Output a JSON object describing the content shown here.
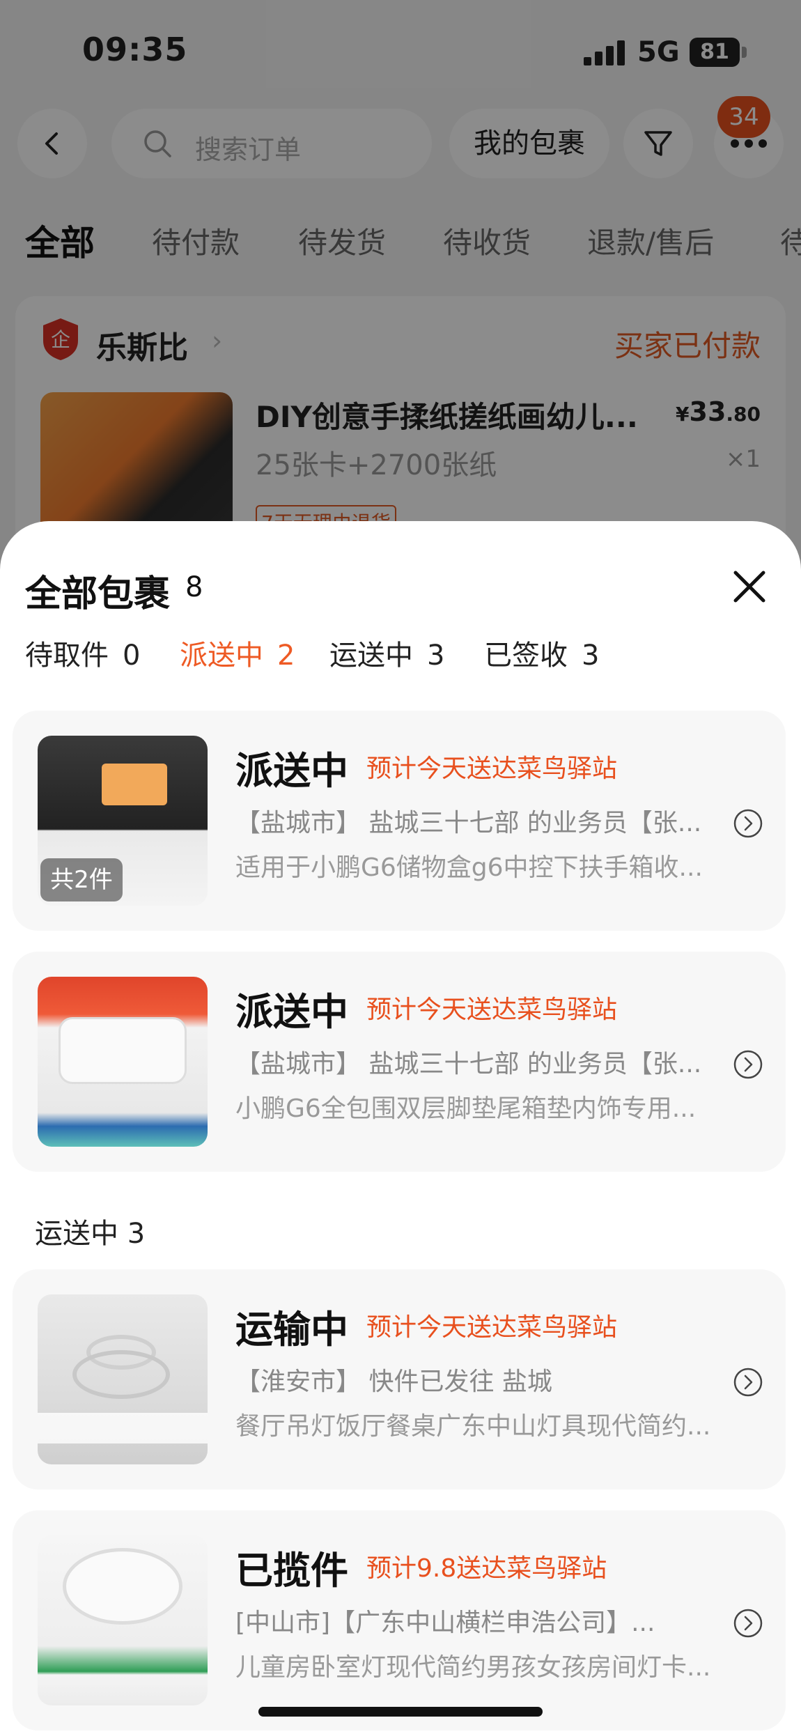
{
  "status_bar": {
    "time": "09:35",
    "network": "5G",
    "battery": "81"
  },
  "header": {
    "search_placeholder": "搜索订单",
    "my_packages": "我的包裹",
    "badge_count": "34"
  },
  "tabs": [
    "全部",
    "待付款",
    "待发货",
    "待收货",
    "退款/售后",
    "待"
  ],
  "order": {
    "shop_name": "乐斯比",
    "status": "买家已付款",
    "product_title": "DIY创意手揉纸搓纸画幼儿...",
    "price_symbol": "¥",
    "price_int": "33",
    "price_dec": ".80",
    "spec": "25张卡+2700张纸",
    "qty": "×1",
    "tag": "7天无理由退货"
  },
  "sheet": {
    "title": "全部包裹",
    "count": "8",
    "filters": [
      {
        "label": "待取件",
        "count": "0"
      },
      {
        "label": "派送中",
        "count": "2"
      },
      {
        "label": "运送中",
        "count": "3"
      },
      {
        "label": "已签收",
        "count": "3"
      }
    ],
    "section_label": "运送中 3",
    "packages": [
      {
        "status": "派送中",
        "eta": "预计今天送达菜鸟驿站",
        "route": "【盐城市】 盐城三十七部 的业务员【张...",
        "product": "适用于小鹏G6储物盒g6中控下扶手箱收...",
        "count_overlay": "共2件"
      },
      {
        "status": "派送中",
        "eta": "预计今天送达菜鸟驿站",
        "route": "【盐城市】 盐城三十七部 的业务员【张...",
        "product": "小鹏G6全包围双层脚垫尾箱垫内饰专用..."
      },
      {
        "status": "运输中",
        "eta": "预计今天送达菜鸟驿站",
        "route": "【淮安市】 快件已发往 盐城",
        "product": "餐厅吊灯饭厅餐桌广东中山灯具现代简约..."
      },
      {
        "status": "已揽件",
        "eta": "预计9.8送达菜鸟驿站",
        "route": "[中山市]【广东中山横栏申浩公司】...",
        "product": "儿童房卧室灯现代简约男孩女孩房间灯卡..."
      }
    ]
  },
  "colors": {
    "accent": "#ee5a24",
    "badge": "#e8501e"
  }
}
